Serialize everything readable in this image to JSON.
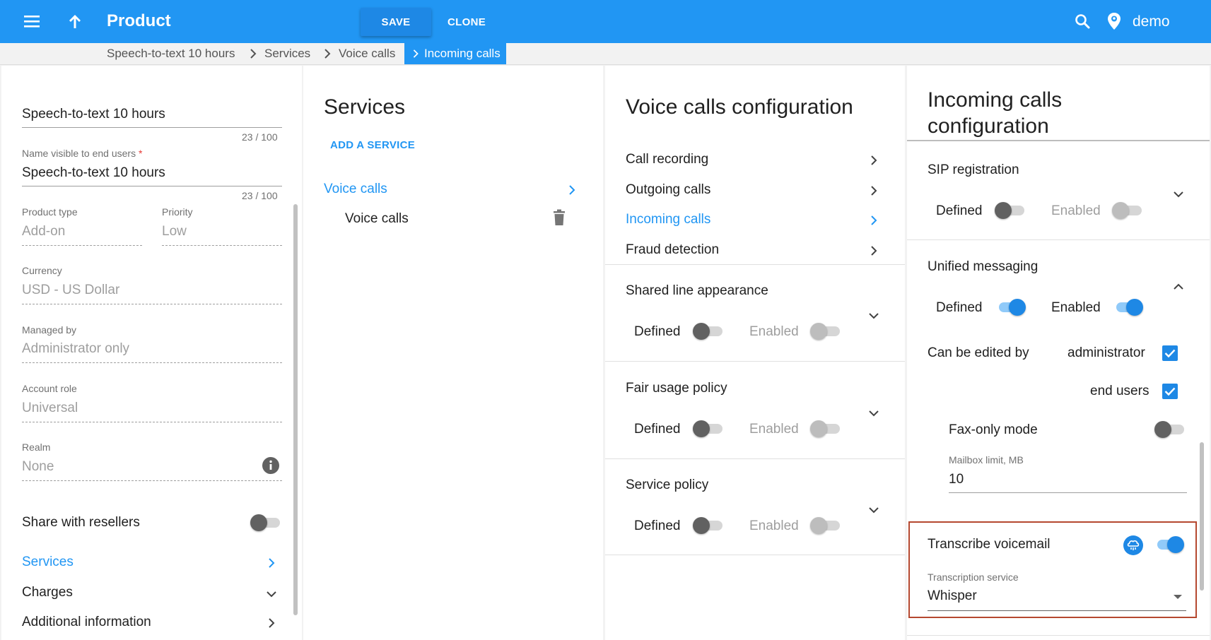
{
  "topbar": {
    "title": "Product",
    "save_label": "SAVE",
    "clone_label": "CLONE",
    "user": "demo"
  },
  "breadcrumb": {
    "items": [
      "Speech-to-text 10 hours",
      "Services",
      "Voice calls"
    ],
    "active": "Incoming calls"
  },
  "product_panel": {
    "name_value": "Speech-to-text 10 hours",
    "name_counter": "23 / 100",
    "visible_name_label": "Name visible to end users",
    "visible_name_required": "*",
    "visible_name_value": "Speech-to-text 10 hours",
    "visible_name_counter": "23 / 100",
    "product_type_label": "Product type",
    "product_type_value": "Add-on",
    "priority_label": "Priority",
    "priority_value": "Low",
    "currency_label": "Currency",
    "currency_value": "USD - US Dollar",
    "managed_by_label": "Managed by",
    "managed_by_value": "Administrator only",
    "account_role_label": "Account role",
    "account_role_value": "Universal",
    "realm_label": "Realm",
    "realm_value": "None",
    "share_label": "Share with resellers",
    "share_on": false,
    "nav": {
      "services": "Services",
      "charges": "Charges",
      "additional": "Additional information"
    }
  },
  "services_panel": {
    "title": "Services",
    "add_label": "ADD A SERVICE",
    "group": "Voice calls",
    "item": "Voice calls"
  },
  "voice_panel": {
    "title": "Voice calls configuration",
    "items": [
      "Call recording",
      "Outgoing calls",
      "Incoming calls",
      "Fraud detection"
    ],
    "sections": [
      {
        "title": "Shared line appearance",
        "defined": "Defined",
        "enabled": "Enabled"
      },
      {
        "title": "Fair usage policy",
        "defined": "Defined",
        "enabled": "Enabled"
      },
      {
        "title": "Service policy",
        "defined": "Defined",
        "enabled": "Enabled"
      }
    ]
  },
  "incoming_panel": {
    "title_line1": "Incoming calls",
    "title_line2": "configuration",
    "sip": {
      "title": "SIP registration",
      "defined": "Defined",
      "enabled": "Enabled",
      "defined_on": false,
      "enabled_on": false
    },
    "um": {
      "title": "Unified messaging",
      "defined": "Defined",
      "enabled": "Enabled",
      "defined_on": true,
      "enabled_on": true,
      "edited_by_label": "Can be edited by",
      "admin_label": "administrator",
      "admin_checked": true,
      "end_users_label": "end users",
      "end_users_checked": true,
      "fax_label": "Fax-only mode",
      "fax_on": false,
      "mailbox_label": "Mailbox limit, MB",
      "mailbox_value": "10"
    },
    "transcribe": {
      "label": "Transcribe voicemail",
      "on": true,
      "service_label": "Transcription service",
      "service_value": "Whisper"
    }
  },
  "colors": {
    "accent": "#2196f3",
    "highlight": "#b5482f"
  }
}
